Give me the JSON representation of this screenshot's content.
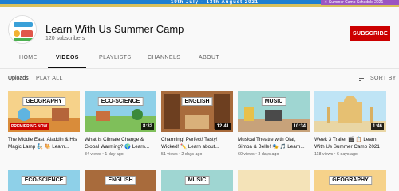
{
  "banner": {
    "dates_text": "19th July – 13th August 2021",
    "badge_text": "☀ Summer Camp Schedule 2021"
  },
  "channel": {
    "name": "Learn With Us Summer Camp",
    "subscribers": "120 subscribers",
    "subscribe_label": "SUBSCRIBE"
  },
  "tabs": [
    "HOME",
    "VIDEOS",
    "PLAYLISTS",
    "CHANNELS",
    "ABOUT"
  ],
  "filters": {
    "uploads": "Uploads",
    "play_all": "PLAY ALL",
    "sort_by": "SORT BY"
  },
  "videos": [
    {
      "thumb_label": "GEOGRAPHY",
      "title": "The Middle East, Aladdin & His Magic Lamp 🧞 🐫 Learn...",
      "meta": "",
      "badge": "PREMIERING NOW",
      "duration": ""
    },
    {
      "thumb_label": "ECO-SCIENCE",
      "title": "What Is Climate Change & Global Warming? 🌍 Learn...",
      "meta": "34 views • 1 day ago",
      "badge": "",
      "duration": "8:32"
    },
    {
      "thumb_label": "ENGLISH",
      "title": "Charming! Perfect! Tasty! Wicked! ✏️ Learn about...",
      "meta": "51 views • 2 days ago",
      "badge": "",
      "duration": "12:41"
    },
    {
      "thumb_label": "MUSIC",
      "title": "Musical Theatre with Olaf, Simba & Belle! 🎭 🎵 Learn...",
      "meta": "60 views • 3 days ago",
      "badge": "",
      "duration": "10:34"
    },
    {
      "thumb_label": "",
      "title": "Week 3 Trailer 🎬 📋 Learn With Us Summer Camp 2021",
      "meta": "118 views • 6 days ago",
      "badge": "",
      "duration": "1:46"
    }
  ],
  "videos_row2": [
    {
      "thumb_label": "ECO-SCIENCE"
    },
    {
      "thumb_label": "ENGLISH"
    },
    {
      "thumb_label": "MUSIC"
    },
    {
      "thumb_label": ""
    },
    {
      "thumb_label": "GEOGRAPHY"
    }
  ],
  "colors": {
    "subscribe": "#cc0000",
    "banner": "#1f7fd0",
    "banner_badge": "#9b55c2"
  }
}
